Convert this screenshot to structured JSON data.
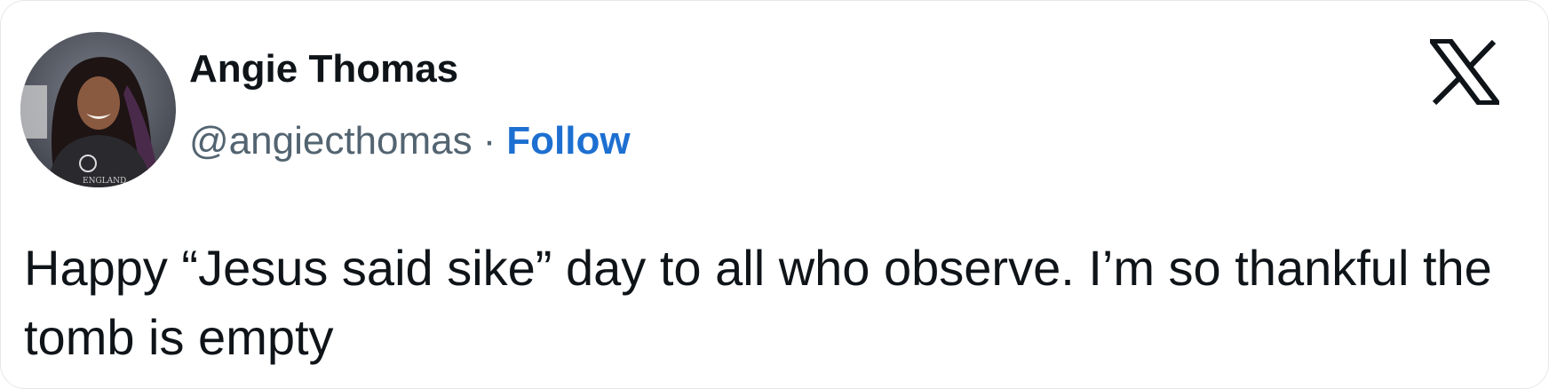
{
  "author": {
    "name": "Angie Thomas",
    "handle": "@angiecthomas",
    "separator": "·",
    "follow_label": "Follow",
    "avatar_badge_text": "ENGLAND"
  },
  "brand": {
    "logo_icon": "x-logo-icon"
  },
  "tweet": {
    "text": "Happy “Jesus said sike” day to all who observe. I’m so thankful the tomb is empty"
  },
  "colors": {
    "follow": "#1d6fd1",
    "text": "#0f1419",
    "secondary": "#536471"
  }
}
